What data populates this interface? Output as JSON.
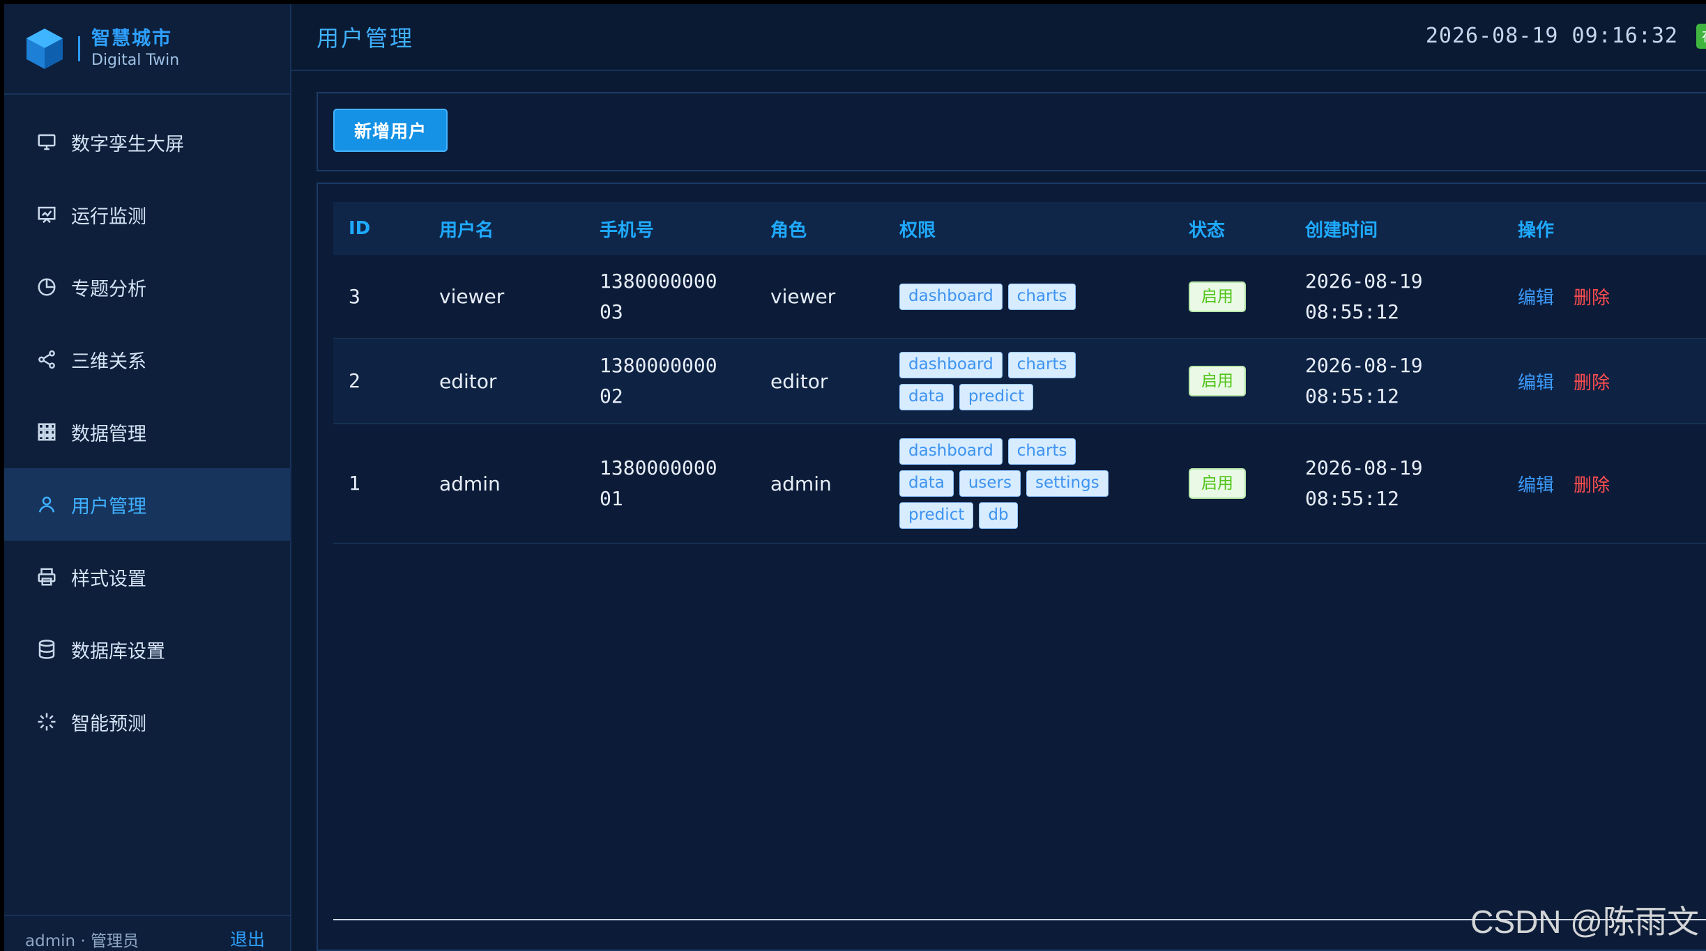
{
  "brand": {
    "title": "智慧城市",
    "subtitle": "Digital Twin"
  },
  "sidebar": {
    "items": [
      {
        "label": "数字孪生大屏",
        "icon": "monitor-icon"
      },
      {
        "label": "运行监测",
        "icon": "chart-board-icon"
      },
      {
        "label": "专题分析",
        "icon": "pie-chart-icon"
      },
      {
        "label": "三维关系",
        "icon": "share-nodes-icon"
      },
      {
        "label": "数据管理",
        "icon": "grid-icon"
      },
      {
        "label": "用户管理",
        "icon": "user-icon",
        "active": true
      },
      {
        "label": "样式设置",
        "icon": "printer-icon"
      },
      {
        "label": "数据库设置",
        "icon": "database-icon"
      },
      {
        "label": "智能预测",
        "icon": "loading-burst-icon"
      }
    ],
    "footer": {
      "user": "admin · 管理员",
      "logout": "退出"
    }
  },
  "header": {
    "title": "用户管理",
    "datetime": "2026-08-19 09:16:32",
    "online_badge": "在"
  },
  "toolbar": {
    "add_label": "新增用户"
  },
  "table": {
    "columns": [
      "ID",
      "用户名",
      "手机号",
      "角色",
      "权限",
      "状态",
      "创建时间",
      "操作"
    ],
    "rows": [
      {
        "id": "3",
        "username": "viewer",
        "phone_l1": "1380000000",
        "phone_l2": "03",
        "role": "viewer",
        "perms": [
          "dashboard",
          "charts"
        ],
        "status": "启用",
        "date": "2026-08-19",
        "time": "08:55:12",
        "edit": "编辑",
        "delete": "删除"
      },
      {
        "id": "2",
        "username": "editor",
        "phone_l1": "1380000000",
        "phone_l2": "02",
        "role": "editor",
        "perms": [
          "dashboard",
          "charts",
          "data",
          "predict"
        ],
        "status": "启用",
        "date": "2026-08-19",
        "time": "08:55:12",
        "edit": "编辑",
        "delete": "删除"
      },
      {
        "id": "1",
        "username": "admin",
        "phone_l1": "1380000000",
        "phone_l2": "01",
        "role": "admin",
        "perms": [
          "dashboard",
          "charts",
          "data",
          "users",
          "settings",
          "predict",
          "db"
        ],
        "status": "启用",
        "date": "2026-08-19",
        "time": "08:55:12",
        "edit": "编辑",
        "delete": "删除"
      }
    ]
  },
  "watermark": "CSDN @陈雨文",
  "colors": {
    "accent": "#1faaff",
    "bg": "#0a1a33",
    "danger": "#ff4d4f",
    "success": "#52c41a"
  }
}
